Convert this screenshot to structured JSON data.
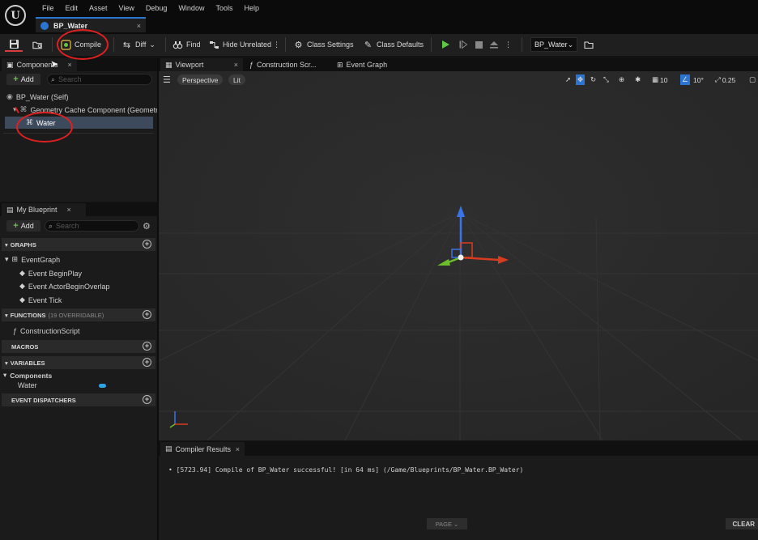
{
  "menu": {
    "items": [
      "File",
      "Edit",
      "Asset",
      "View",
      "Debug",
      "Window",
      "Tools",
      "Help"
    ]
  },
  "document_tab": {
    "title": "BP_Water",
    "close": "×"
  },
  "toolbar": {
    "compile_label": "Compile",
    "diff_label": "Diff",
    "find_label": "Find",
    "hide_unrelated_label": "Hide Unrelated",
    "class_settings_label": "Class Settings",
    "class_defaults_label": "Class Defaults",
    "debug_object": "BP_Water"
  },
  "components_panel": {
    "tab_label": "Components",
    "add_label": "Add",
    "search_placeholder": "Search",
    "tree": [
      {
        "label": "BP_Water (Self)"
      },
      {
        "label": "Geometry Cache Component (Geometry"
      },
      {
        "label": "Water",
        "selected": true
      }
    ]
  },
  "my_blueprint": {
    "tab_label": "My Blueprint",
    "add_label": "Add",
    "search_placeholder": "Search",
    "graphs_header": "GRAPHS",
    "event_graph": "EventGraph",
    "events": [
      "Event BeginPlay",
      "Event ActorBeginOverlap",
      "Event Tick"
    ],
    "functions_header": "FUNCTIONS",
    "functions_hint": "(19 OVERRIDABLE)",
    "construction_script": "ConstructionScript",
    "macros_header": "MACROS",
    "variables_header": "VARIABLES",
    "components_category": "Components",
    "water_variable": "Water",
    "dispatchers_header": "EVENT DISPATCHERS"
  },
  "editor_tabs": {
    "viewport": "Viewport",
    "construction": "Construction Scr...",
    "event_graph": "Event Graph"
  },
  "viewport": {
    "perspective": "Perspective",
    "lit": "Lit",
    "grid_snap": "10",
    "rotation_snap": "10°",
    "scale_snap": "0.25"
  },
  "compiler_results": {
    "tab_label": "Compiler Results",
    "message": "[5723.94] Compile of BP_Water successful! [in 64 ms] (/Game/Blueprints/BP_Water.BP_Water)",
    "page_label": "PAGE",
    "clear_label": "CLEAR"
  },
  "colors": {
    "accent_blue": "#2b74d1",
    "play_green": "#5fc646",
    "annotation_red": "#e02020"
  }
}
